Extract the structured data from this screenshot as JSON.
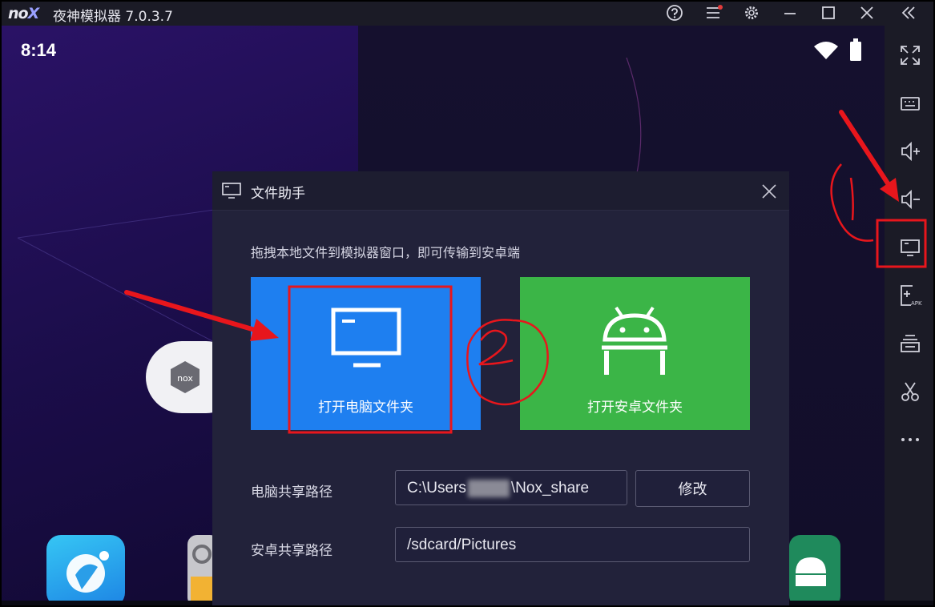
{
  "app": {
    "logo": "nox",
    "title": "夜神模拟器 7.0.3.7",
    "titlebar_icons": [
      "help-icon",
      "menu-icon",
      "settings-icon",
      "minimize-icon",
      "maximize-icon",
      "close-icon",
      "collapse-icon"
    ]
  },
  "android": {
    "time": "8:14",
    "status_icons": [
      "wifi-icon",
      "battery-icon"
    ]
  },
  "sidebar": {
    "items": [
      "fullscreen-icon",
      "keyboard-icon",
      "volume-up-icon",
      "volume-down-icon",
      "file-assistant-icon",
      "install-apk-icon",
      "multi-instance-icon",
      "screenshot-icon",
      "more-icon"
    ]
  },
  "dialog": {
    "title": "文件助手",
    "hint": "拖拽本地文件到模拟器窗口，即可传输到安卓端",
    "pc_folder_label": "打开电脑文件夹",
    "android_folder_label": "打开安卓文件夹",
    "pc_path_label": "电脑共享路径",
    "pc_path_prefix": "C:\\Users",
    "pc_path_suffix": "\\Nox_share",
    "modify_label": "修改",
    "android_path_label": "安卓共享路径",
    "android_path_value": "/sdcard/Pictures"
  },
  "annotations": {
    "marker_1": "1",
    "marker_2": "2",
    "color": "#e8161c"
  }
}
